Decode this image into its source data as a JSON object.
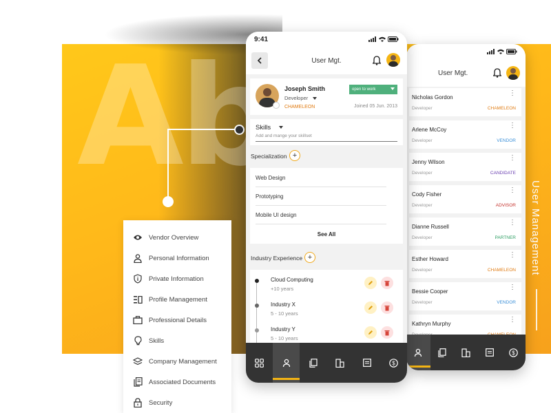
{
  "banner": {
    "watermark": "Ab",
    "side_title": "User Management"
  },
  "menu": {
    "items": [
      {
        "label": "Vendor Overview",
        "icon": "eye-icon"
      },
      {
        "label": "Personal Information",
        "icon": "person-icon"
      },
      {
        "label": "Private Information",
        "icon": "info-shield-icon"
      },
      {
        "label": "Profile Management",
        "icon": "profile-list-icon"
      },
      {
        "label": "Professional Details",
        "icon": "briefcase-icon"
      },
      {
        "label": "Skills",
        "icon": "lightbulb-icon"
      },
      {
        "label": "Company Management",
        "icon": "layers-icon"
      },
      {
        "label": "Associated Documents",
        "icon": "documents-icon"
      },
      {
        "label": "Security",
        "icon": "lock-icon"
      }
    ]
  },
  "front_phone": {
    "status_time": "9:41",
    "header_title": "User Mgt.",
    "profile": {
      "name": "Joseph Smith",
      "role": "Developer",
      "vendor": "CHAMELEON",
      "joined": "Joined 05 Jun. 2013",
      "work_status": "open to work"
    },
    "skills": {
      "title": "Skills",
      "hint": "Add and mange your skillset"
    },
    "specialization": {
      "title": "Specialization",
      "items": [
        "Web Design",
        "Prototyping",
        "Mobile UI design"
      ],
      "see_all": "See All"
    },
    "industry_experience": {
      "title": "Industry Experience",
      "items": [
        {
          "name": "Cloud Computing",
          "years": "+10 years"
        },
        {
          "name": "Industry X",
          "years": "5 - 10 years"
        },
        {
          "name": "Industry Y",
          "years": "5 - 10 years"
        }
      ]
    }
  },
  "back_phone": {
    "header_title": "User Mgt.",
    "users": [
      {
        "name": "Nicholas Gordon",
        "role": "Developer",
        "status": "CHAMELEON",
        "status_color": "#e07a10"
      },
      {
        "name": "Arlene McCoy",
        "role": "Developer",
        "status": "VENDOR",
        "status_color": "#3a8fd8"
      },
      {
        "name": "Jenny Wilson",
        "role": "Developer",
        "status": "CANDIDATE",
        "status_color": "#6a3fb0"
      },
      {
        "name": "Cody Fisher",
        "role": "Developer",
        "status": "ADVISOR",
        "status_color": "#c4302b"
      },
      {
        "name": "Dianne Russell",
        "role": "Developer",
        "status": "PARTNER",
        "status_color": "#2e9e63"
      },
      {
        "name": "Esther Howard",
        "role": "Developer",
        "status": "CHAMELEON",
        "status_color": "#e07a10"
      },
      {
        "name": "Bessie Cooper",
        "role": "Developer",
        "status": "VENDOR",
        "status_color": "#3a8fd8"
      },
      {
        "name": "Kathryn Murphy",
        "role": "Developer",
        "status": "CHAMELEON",
        "status_color": "#e07a10"
      }
    ]
  },
  "colors": {
    "accent": "#f5b514",
    "tabbar": "#333333",
    "success": "#4fb07c"
  }
}
